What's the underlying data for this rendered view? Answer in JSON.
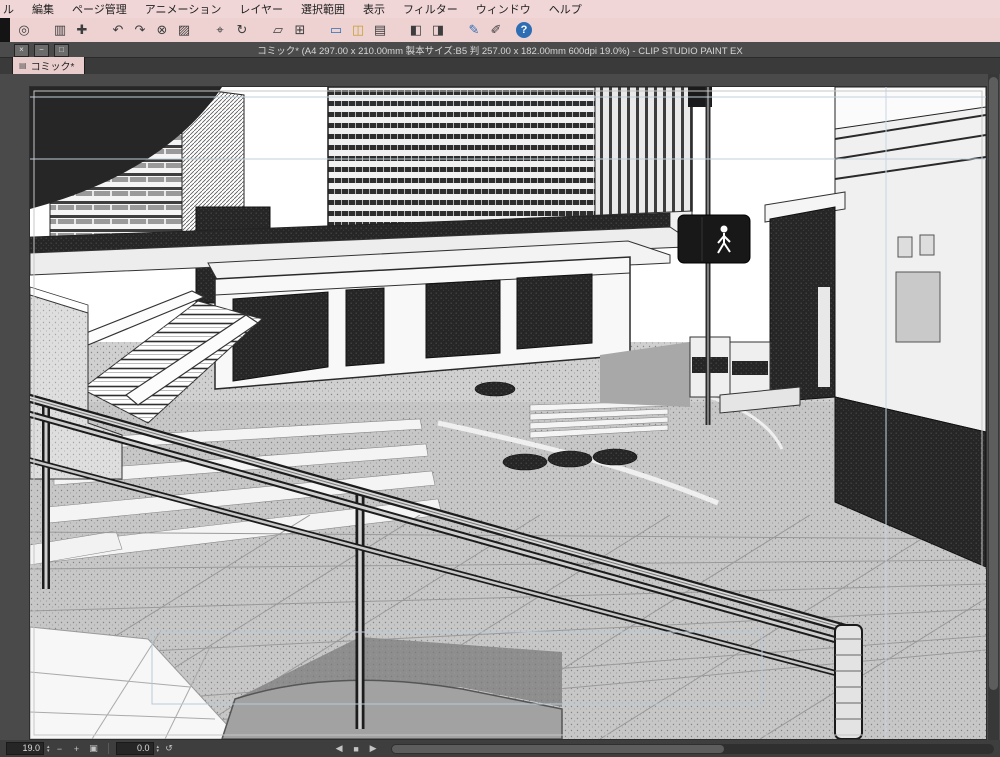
{
  "app": {
    "title": "コミック* (A4 297.00 x 210.00mm 製本サイズ:B5 判 257.00 x 182.00mm 600dpi 19.0%)  - CLIP STUDIO PAINT EX"
  },
  "window_buttons": [
    {
      "name": "close",
      "glyph": "×"
    },
    {
      "name": "minimize",
      "glyph": "−"
    },
    {
      "name": "maximize",
      "glyph": "□"
    }
  ],
  "menu": {
    "items": [
      "ル",
      "編集",
      "ページ管理",
      "アニメーション",
      "レイヤー",
      "選択範囲",
      "表示",
      "フィルター",
      "ウィンドウ",
      "ヘルプ"
    ]
  },
  "toolbar": {
    "icons": [
      {
        "name": "clip-studio-logo-icon",
        "glyph": "◎"
      },
      {
        "name": "screen-mode-icon",
        "glyph": "▥"
      },
      {
        "name": "pan-tool-icon",
        "glyph": "✚"
      },
      {
        "name": "undo-icon",
        "glyph": "↶"
      },
      {
        "name": "redo-icon",
        "glyph": "↷"
      },
      {
        "name": "clear-icon",
        "glyph": "⊗"
      },
      {
        "name": "fill-icon",
        "glyph": "▨"
      },
      {
        "name": "crosshair-icon",
        "glyph": "⌖"
      },
      {
        "name": "rotate-icon",
        "glyph": "↻"
      },
      {
        "name": "transform-icon",
        "glyph": "▱"
      },
      {
        "name": "grid-icon",
        "glyph": "⊞"
      },
      {
        "name": "snap-ruler-icon",
        "glyph": "▭"
      },
      {
        "name": "snap-special-ruler-icon",
        "glyph": "◫"
      },
      {
        "name": "snap-grid-icon",
        "glyph": "▤"
      },
      {
        "name": "flip-horizontal-icon",
        "glyph": "◧"
      },
      {
        "name": "flip-vertical-icon",
        "glyph": "◨"
      },
      {
        "name": "pen-icon",
        "glyph": "✎"
      },
      {
        "name": "brush-icon",
        "glyph": "✐"
      },
      {
        "name": "help-icon",
        "glyph": "?"
      }
    ]
  },
  "tab": {
    "label": "コミック*",
    "icon": "▤"
  },
  "statusbar": {
    "zoom_value": "19.0",
    "rotation_value": "0.0",
    "spinner_up": "▴",
    "spinner_down": "▾",
    "icons": [
      {
        "name": "zoom-out",
        "glyph": "−"
      },
      {
        "name": "zoom-in",
        "glyph": "+"
      },
      {
        "name": "fit-to-screen",
        "glyph": "▣"
      },
      {
        "name": "reset-rotation",
        "glyph": "↺"
      },
      {
        "name": "prev-page",
        "glyph": "◀"
      },
      {
        "name": "page-indicator",
        "glyph": "■"
      },
      {
        "name": "next-page",
        "glyph": "▶"
      }
    ]
  },
  "colors": {
    "menubar_bg": "#f0d6d6",
    "toolbar_bg": "#eed2d2",
    "titlebar_bg": "#4b4b4b",
    "tab_bg": "#e9cccc",
    "canvas_surround": "#4a4a4a",
    "statusbar_bg": "#3e3e3e",
    "accent_blue": "#2e6db4",
    "accent_yellow": "#c79f2f",
    "guide_blue": "#b9c8da"
  }
}
